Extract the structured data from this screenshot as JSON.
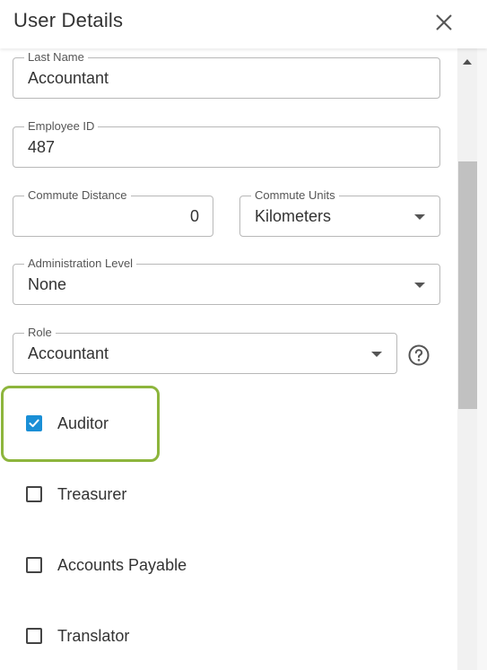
{
  "dialog": {
    "title": "User Details",
    "close_icon": "close-icon"
  },
  "fields": {
    "last_name": {
      "label": "Last Name",
      "value": "Accountant"
    },
    "employee_id": {
      "label": "Employee ID",
      "value": "487"
    },
    "commute_distance": {
      "label": "Commute Distance",
      "value": "0"
    },
    "commute_units": {
      "label": "Commute Units",
      "value": "Kilometers"
    },
    "administration_level": {
      "label": "Administration Level",
      "value": "None"
    },
    "role": {
      "label": "Role",
      "value": "Accountant"
    }
  },
  "help_icon": "help-circle-icon",
  "checkboxes": [
    {
      "label": "Auditor",
      "checked": true
    },
    {
      "label": "Treasurer",
      "checked": false
    },
    {
      "label": "Accounts Payable",
      "checked": false
    },
    {
      "label": "Translator",
      "checked": false
    }
  ],
  "colors": {
    "checkbox_checked": "#1a8fd6",
    "highlight_border": "#8db53c"
  }
}
